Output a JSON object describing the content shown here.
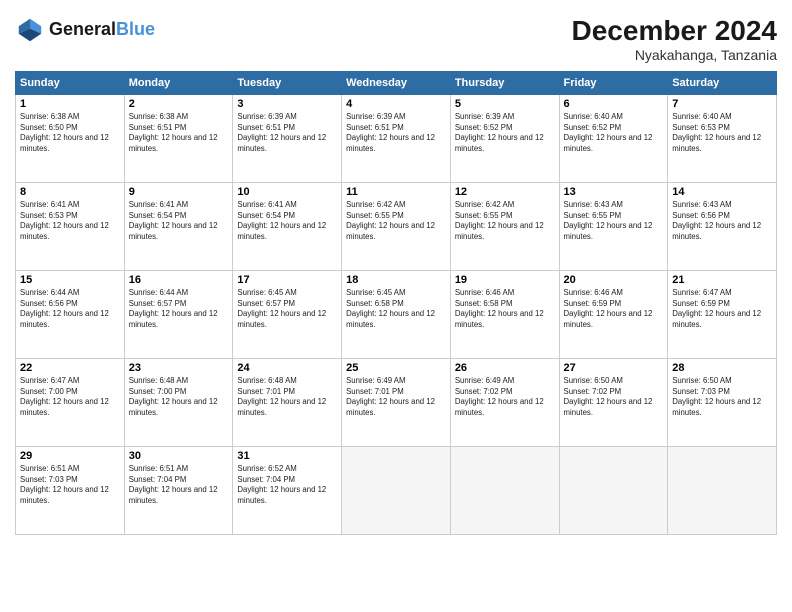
{
  "header": {
    "logo_line1": "General",
    "logo_line2": "Blue",
    "month_title": "December 2024",
    "location": "Nyakahanga, Tanzania"
  },
  "weekdays": [
    "Sunday",
    "Monday",
    "Tuesday",
    "Wednesday",
    "Thursday",
    "Friday",
    "Saturday"
  ],
  "weeks": [
    [
      {
        "day": 1,
        "sunrise": "6:38 AM",
        "sunset": "6:50 PM",
        "daylight": "12 hours and 12 minutes."
      },
      {
        "day": 2,
        "sunrise": "6:38 AM",
        "sunset": "6:51 PM",
        "daylight": "12 hours and 12 minutes."
      },
      {
        "day": 3,
        "sunrise": "6:39 AM",
        "sunset": "6:51 PM",
        "daylight": "12 hours and 12 minutes."
      },
      {
        "day": 4,
        "sunrise": "6:39 AM",
        "sunset": "6:51 PM",
        "daylight": "12 hours and 12 minutes."
      },
      {
        "day": 5,
        "sunrise": "6:39 AM",
        "sunset": "6:52 PM",
        "daylight": "12 hours and 12 minutes."
      },
      {
        "day": 6,
        "sunrise": "6:40 AM",
        "sunset": "6:52 PM",
        "daylight": "12 hours and 12 minutes."
      },
      {
        "day": 7,
        "sunrise": "6:40 AM",
        "sunset": "6:53 PM",
        "daylight": "12 hours and 12 minutes."
      }
    ],
    [
      {
        "day": 8,
        "sunrise": "6:41 AM",
        "sunset": "6:53 PM",
        "daylight": "12 hours and 12 minutes."
      },
      {
        "day": 9,
        "sunrise": "6:41 AM",
        "sunset": "6:54 PM",
        "daylight": "12 hours and 12 minutes."
      },
      {
        "day": 10,
        "sunrise": "6:41 AM",
        "sunset": "6:54 PM",
        "daylight": "12 hours and 12 minutes."
      },
      {
        "day": 11,
        "sunrise": "6:42 AM",
        "sunset": "6:55 PM",
        "daylight": "12 hours and 12 minutes."
      },
      {
        "day": 12,
        "sunrise": "6:42 AM",
        "sunset": "6:55 PM",
        "daylight": "12 hours and 12 minutes."
      },
      {
        "day": 13,
        "sunrise": "6:43 AM",
        "sunset": "6:55 PM",
        "daylight": "12 hours and 12 minutes."
      },
      {
        "day": 14,
        "sunrise": "6:43 AM",
        "sunset": "6:56 PM",
        "daylight": "12 hours and 12 minutes."
      }
    ],
    [
      {
        "day": 15,
        "sunrise": "6:44 AM",
        "sunset": "6:56 PM",
        "daylight": "12 hours and 12 minutes."
      },
      {
        "day": 16,
        "sunrise": "6:44 AM",
        "sunset": "6:57 PM",
        "daylight": "12 hours and 12 minutes."
      },
      {
        "day": 17,
        "sunrise": "6:45 AM",
        "sunset": "6:57 PM",
        "daylight": "12 hours and 12 minutes."
      },
      {
        "day": 18,
        "sunrise": "6:45 AM",
        "sunset": "6:58 PM",
        "daylight": "12 hours and 12 minutes."
      },
      {
        "day": 19,
        "sunrise": "6:46 AM",
        "sunset": "6:58 PM",
        "daylight": "12 hours and 12 minutes."
      },
      {
        "day": 20,
        "sunrise": "6:46 AM",
        "sunset": "6:59 PM",
        "daylight": "12 hours and 12 minutes."
      },
      {
        "day": 21,
        "sunrise": "6:47 AM",
        "sunset": "6:59 PM",
        "daylight": "12 hours and 12 minutes."
      }
    ],
    [
      {
        "day": 22,
        "sunrise": "6:47 AM",
        "sunset": "7:00 PM",
        "daylight": "12 hours and 12 minutes."
      },
      {
        "day": 23,
        "sunrise": "6:48 AM",
        "sunset": "7:00 PM",
        "daylight": "12 hours and 12 minutes."
      },
      {
        "day": 24,
        "sunrise": "6:48 AM",
        "sunset": "7:01 PM",
        "daylight": "12 hours and 12 minutes."
      },
      {
        "day": 25,
        "sunrise": "6:49 AM",
        "sunset": "7:01 PM",
        "daylight": "12 hours and 12 minutes."
      },
      {
        "day": 26,
        "sunrise": "6:49 AM",
        "sunset": "7:02 PM",
        "daylight": "12 hours and 12 minutes."
      },
      {
        "day": 27,
        "sunrise": "6:50 AM",
        "sunset": "7:02 PM",
        "daylight": "12 hours and 12 minutes."
      },
      {
        "day": 28,
        "sunrise": "6:50 AM",
        "sunset": "7:03 PM",
        "daylight": "12 hours and 12 minutes."
      }
    ],
    [
      {
        "day": 29,
        "sunrise": "6:51 AM",
        "sunset": "7:03 PM",
        "daylight": "12 hours and 12 minutes."
      },
      {
        "day": 30,
        "sunrise": "6:51 AM",
        "sunset": "7:04 PM",
        "daylight": "12 hours and 12 minutes."
      },
      {
        "day": 31,
        "sunrise": "6:52 AM",
        "sunset": "7:04 PM",
        "daylight": "12 hours and 12 minutes."
      },
      null,
      null,
      null,
      null
    ]
  ]
}
